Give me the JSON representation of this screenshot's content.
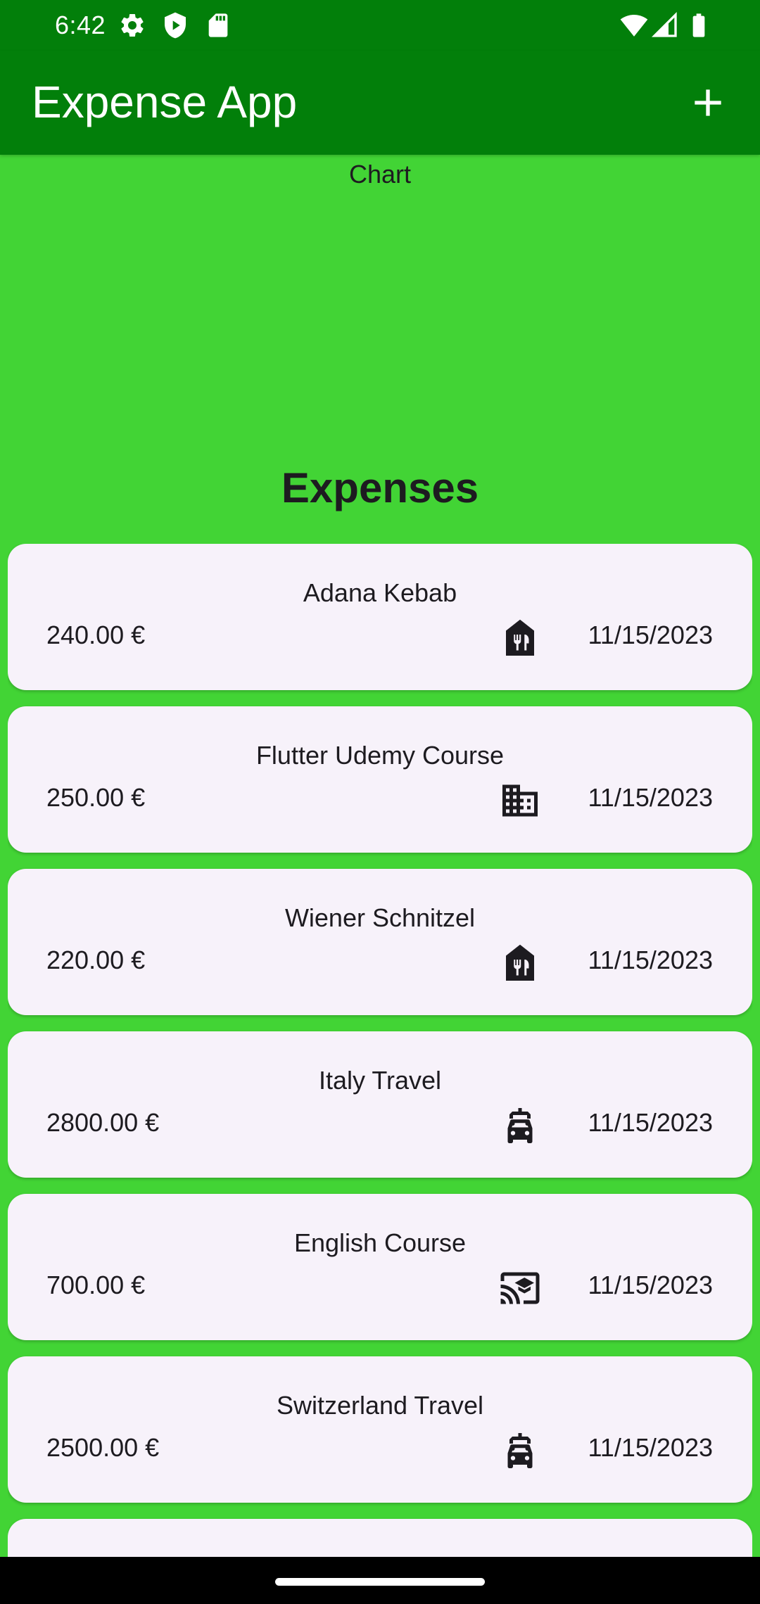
{
  "status_bar": {
    "time": "6:42",
    "left_icons": [
      "settings-icon",
      "shield-play-icon",
      "sd-card-icon"
    ],
    "right_icons": [
      "wifi-icon",
      "cellular-signal-icon",
      "battery-icon"
    ]
  },
  "app_bar": {
    "title": "Expense App",
    "action_icon": "add-icon"
  },
  "colors": {
    "app_bar": "#027f0a",
    "background": "#42d435",
    "card": "#f7f2fa",
    "text": "#1d1b20"
  },
  "chart": {
    "label": "Chart"
  },
  "expenses_heading": "Expenses",
  "expenses": [
    {
      "title": "Adana Kebab",
      "amount": "240.00 €",
      "date": "11/15/2023",
      "icon": "restaurant-icon"
    },
    {
      "title": "Flutter Udemy Course",
      "amount": "250.00 €",
      "date": "11/15/2023",
      "icon": "business-icon"
    },
    {
      "title": "Wiener Schnitzel",
      "amount": "220.00 €",
      "date": "11/15/2023",
      "icon": "restaurant-icon"
    },
    {
      "title": "Italy Travel",
      "amount": "2800.00 €",
      "date": "11/15/2023",
      "icon": "car-rental-icon"
    },
    {
      "title": "English Course",
      "amount": "700.00 €",
      "date": "11/15/2023",
      "icon": "cast-for-education-icon"
    },
    {
      "title": "Switzerland Travel",
      "amount": "2500.00 €",
      "date": "11/15/2023",
      "icon": "car-rental-icon"
    },
    {
      "title": "",
      "amount": "",
      "date": "",
      "icon": ""
    }
  ]
}
